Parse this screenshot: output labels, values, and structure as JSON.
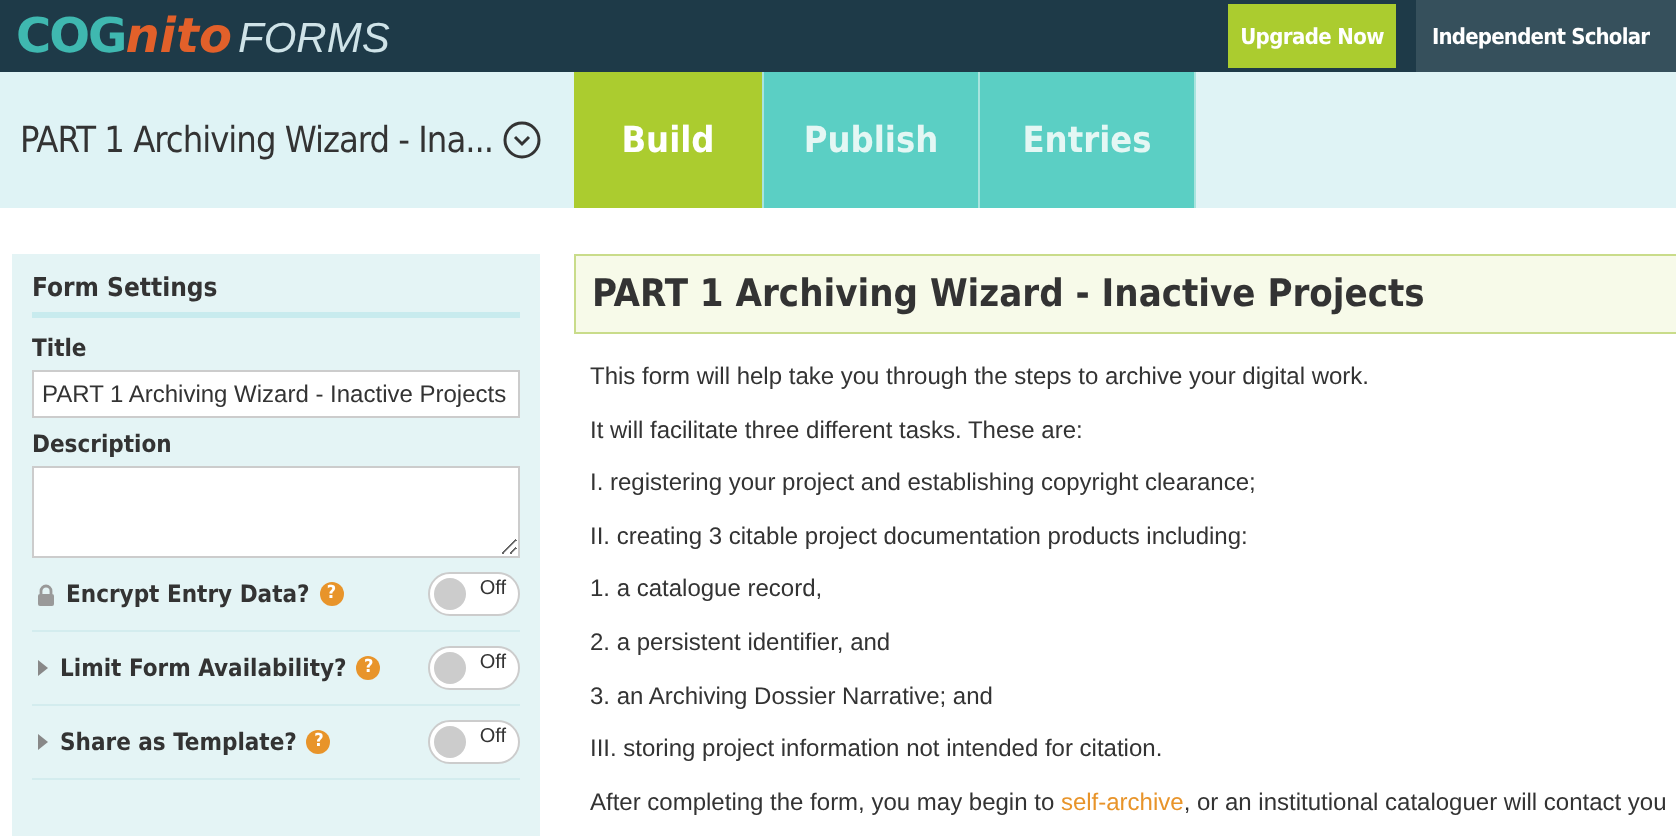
{
  "header": {
    "logo": {
      "part1": "COG",
      "part2": "nito",
      "product": "FORMS"
    },
    "upgrade_button": "Upgrade Now",
    "account": "Independent Scholar"
  },
  "form_bar": {
    "title": "PART 1 Archiving Wizard - Ina...",
    "tabs": [
      {
        "label": "Build",
        "selected": true
      },
      {
        "label": "Publish",
        "selected": false
      },
      {
        "label": "Entries",
        "selected": false
      }
    ]
  },
  "sidebar": {
    "heading": "Form Settings",
    "title_label": "Title",
    "title_value": "PART 1 Archiving Wizard - Inactive Projects",
    "description_label": "Description",
    "settings": [
      {
        "kind": "locked",
        "label": "Encrypt Entry Data?",
        "help": "?",
        "on": false,
        "toggle_text": "Off"
      },
      {
        "kind": "expandable",
        "label": "Limit Form Availability?",
        "help": "?",
        "on": false,
        "toggle_text": "Off"
      },
      {
        "kind": "expandable",
        "label": "Share as Template?",
        "help": "?",
        "on": false,
        "toggle_text": "Off"
      }
    ]
  },
  "main": {
    "heading": "PART 1 Archiving Wizard - Inactive Projects",
    "paragraphs": [
      "This form will help take you through the steps to archive your digital work.",
      "It will facilitate three different tasks. These are:",
      "I. registering your project and establishing copyright clearance;",
      "II. creating 3 citable project documentation products including:",
      "1. a catalogue record,",
      "2. a persistent identifier, and",
      "3. an Archiving Dossier Narrative; and",
      "III. storing project information not intended for citation."
    ],
    "last_paragraph": [
      {
        "kind": "text",
        "text": "After completing the form, you may begin to "
      },
      {
        "kind": "link",
        "text": "self-archive"
      },
      {
        "kind": "text",
        "text": ", or an institutional cataloguer will contact you"
      }
    ]
  }
}
